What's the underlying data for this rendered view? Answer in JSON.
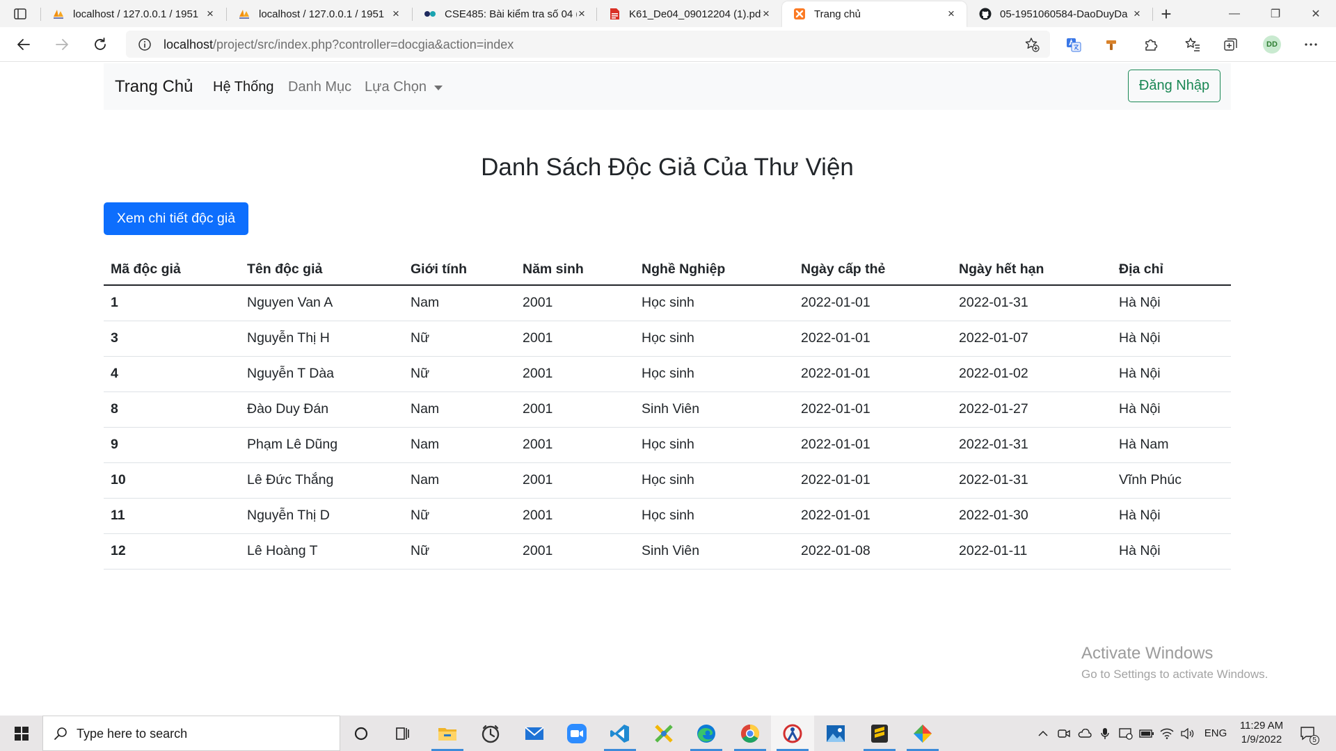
{
  "browser": {
    "tabs": [
      {
        "title": "localhost / 127.0.0.1 / 1951",
        "icon": "phpmyadmin-icon",
        "active": false
      },
      {
        "title": "localhost / 127.0.0.1 / 1951",
        "icon": "phpmyadmin-icon",
        "active": false
      },
      {
        "title": "CSE485: Bài kiểm tra số 04 (",
        "icon": "dots-logo-icon",
        "active": false
      },
      {
        "title": "K61_De04_09012204 (1).pdf",
        "icon": "pdf-icon",
        "active": false
      },
      {
        "title": "Trang chủ",
        "icon": "xampp-icon",
        "active": true
      },
      {
        "title": "05-1951060584-DaoDuyDa",
        "icon": "github-icon",
        "active": false
      }
    ],
    "close_glyph": "×",
    "new_tab_glyph": "+",
    "window_controls": {
      "minimize": "—",
      "restore": "❐",
      "close": "✕"
    },
    "address": {
      "domain": "localhost",
      "path": "/project/src/index.php?controller=docgia&action=index"
    },
    "profile_initials": "DD",
    "toolbar_icons": [
      "back-icon",
      "forward-icon",
      "refresh-icon",
      "site-info-icon",
      "add-favorite-icon",
      "translate-icon",
      "extension-key-icon",
      "extensions-icon",
      "favorites-icon",
      "collections-icon",
      "profile-avatar",
      "more-icon"
    ]
  },
  "page": {
    "navbar": {
      "brand": "Trang Chủ",
      "links": [
        "Hệ Thống",
        "Danh Mục",
        "Lựa Chọn"
      ],
      "active_link": "Hệ Thống",
      "login_button": "Đăng Nhập"
    },
    "heading": "Danh Sách Độc Giả Của Thư Viện",
    "detail_button": "Xem chi tiết độc giả",
    "table": {
      "headers": [
        "Mã độc giả",
        "Tên độc giả",
        "Giới tính",
        "Năm sinh",
        "Nghề Nghiệp",
        "Ngày cấp thẻ",
        "Ngày hết hạn",
        "Địa chỉ"
      ],
      "rows": [
        [
          "1",
          "Nguyen Van A",
          "Nam",
          "2001",
          "Học sinh",
          "2022-01-01",
          "2022-01-31",
          "Hà Nội"
        ],
        [
          "3",
          "Nguyễn Thị H",
          "Nữ",
          "2001",
          "Học sinh",
          "2022-01-01",
          "2022-01-07",
          "Hà Nội"
        ],
        [
          "4",
          "Nguyễn T Dàa",
          "Nữ",
          "2001",
          "Học sinh",
          "2022-01-01",
          "2022-01-02",
          "Hà Nội"
        ],
        [
          "8",
          "Đào Duy Đán",
          "Nam",
          "2001",
          "Sinh Viên",
          "2022-01-01",
          "2022-01-27",
          "Hà Nội"
        ],
        [
          "9",
          "Phạm Lê Dũng",
          "Nam",
          "2001",
          "Học sinh",
          "2022-01-01",
          "2022-01-31",
          "Hà Nam"
        ],
        [
          "10",
          "Lê Đức Thắng",
          "Nam",
          "2001",
          "Học sinh",
          "2022-01-01",
          "2022-01-31",
          "Vĩnh Phúc"
        ],
        [
          "11",
          "Nguyễn Thị D",
          "Nữ",
          "2001",
          "Học sinh",
          "2022-01-01",
          "2022-01-30",
          "Hà Nội"
        ],
        [
          "12",
          "Lê Hoàng T",
          "Nữ",
          "2001",
          "Sinh Viên",
          "2022-01-08",
          "2022-01-11",
          "Hà Nội"
        ]
      ]
    }
  },
  "watermark": {
    "line1": "Activate Windows",
    "line2": "Go to Settings to activate Windows."
  },
  "taskbar": {
    "search_placeholder": "Type here to search",
    "pinned_apps": [
      "file-explorer-icon",
      "alarms-clock-icon",
      "mail-icon",
      "zoom-icon",
      "vscode-icon",
      "cross-arrows-app-icon",
      "edge-icon",
      "chrome-icon",
      "red-app-icon",
      "photos-icon",
      "sublime-text-icon",
      "diamond-app-icon"
    ],
    "language": "ENG",
    "time": "11:29 AM",
    "date": "1/9/2022",
    "notification_count": "5"
  },
  "colors": {
    "primary": "#0d6efd",
    "success": "#198754",
    "navbar_bg": "#f8f9fa",
    "table_border": "#dee2e6"
  }
}
